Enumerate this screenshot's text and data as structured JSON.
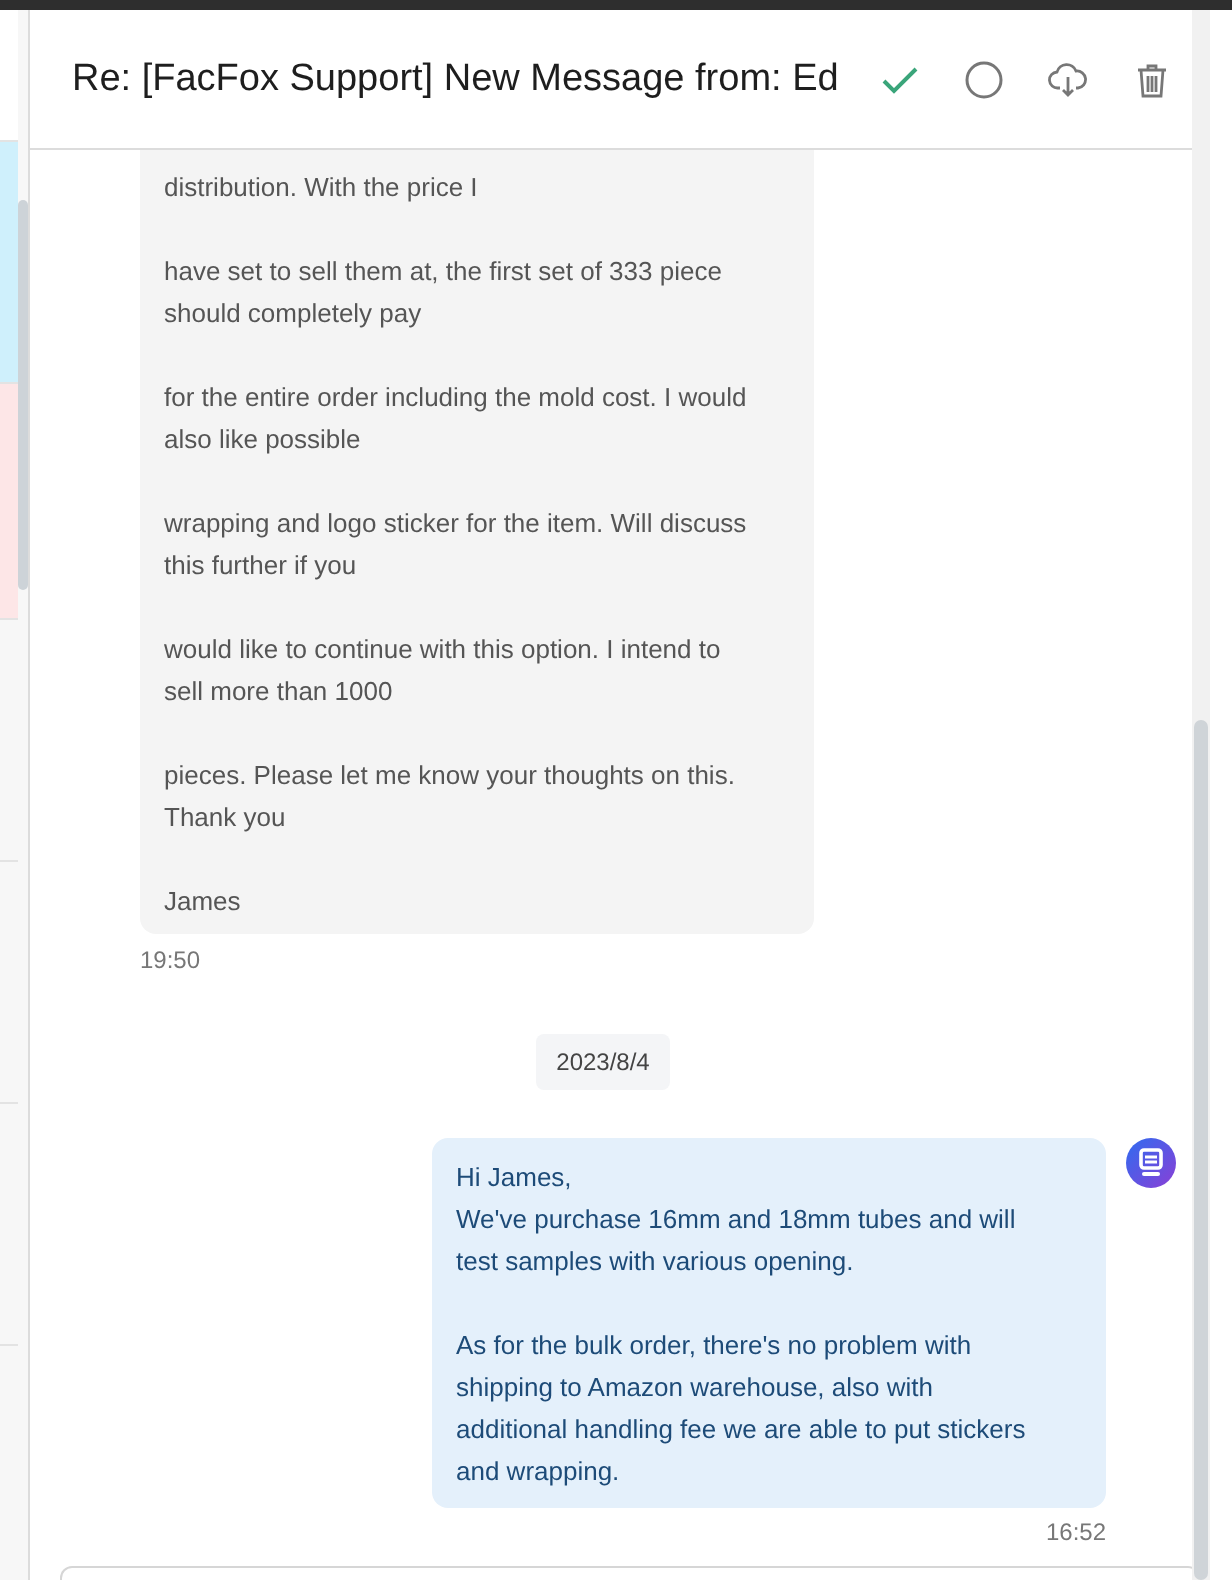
{
  "header": {
    "title": "Re: [FacFox Support] New Message from: Ed"
  },
  "messages": [
    {
      "kind": "received",
      "paragraphs": [
        "distribution. With the price I",
        "have set to sell them at, the first set of 333 piece\nshould completely pay",
        "for the entire order including the mold cost. I would\nalso like possible",
        "wrapping and logo sticker for the item. Will discuss\nthis further if you",
        "would like to continue with this option. I intend to\nsell more than 1000",
        "pieces. Please let me know your thoughts on this.\nThank you",
        "James"
      ],
      "time": "19:50"
    },
    {
      "kind": "date",
      "text": "2023/8/4"
    },
    {
      "kind": "sent",
      "paragraphs": [
        "Hi James,\nWe've purchase 16mm and 18mm tubes and will\ntest samples with various opening.",
        "As for the bulk order, there's no problem with\nshipping to Amazon warehouse, also with\nadditional handling fee we are able to put stickers\nand wrapping."
      ],
      "time": "16:52"
    }
  ]
}
